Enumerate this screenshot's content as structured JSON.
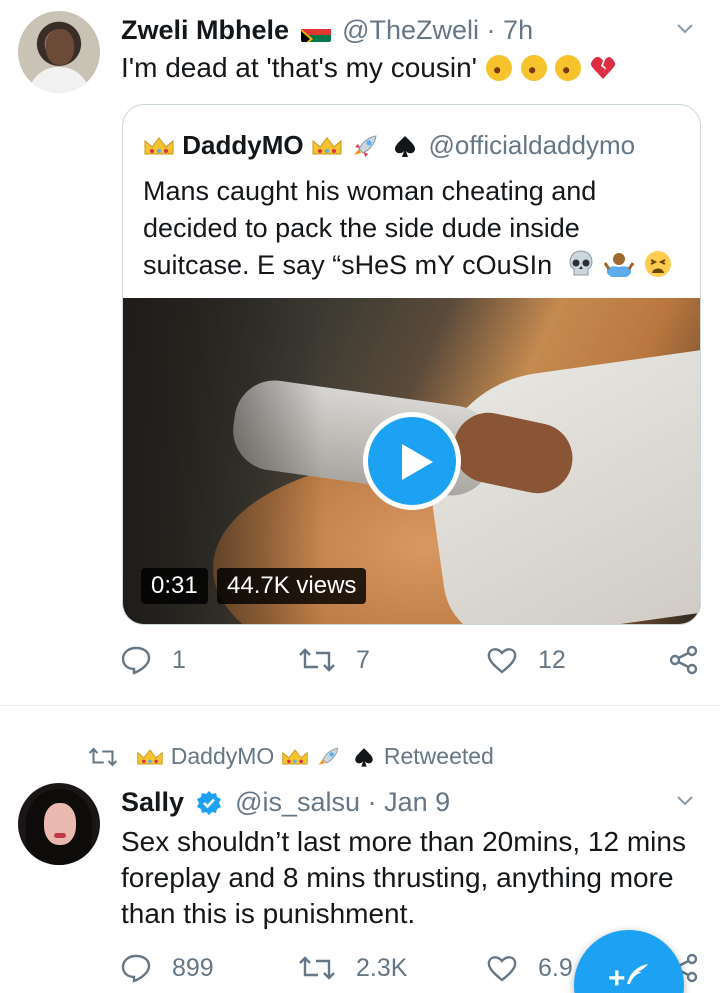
{
  "tweet1": {
    "author_name": "Zweli Mbhele",
    "author_handle": "@TheZweli",
    "separator": "·",
    "time": "7h",
    "text": "I'm dead at 'that's my cousin'",
    "emojis": [
      "rolling-on-floor-laughing",
      "rolling-on-floor-laughing",
      "rolling-on-floor-laughing",
      "broken-heart"
    ],
    "quote": {
      "author_name": "DaddyMO",
      "author_handle": "@officialdaddymo",
      "text": "Mans caught his woman cheating and decided to pack the side dude inside suitcase. E say “sHeS mY cOuSIn",
      "video_duration": "0:31",
      "video_views": "44.7K views"
    },
    "replies": "1",
    "retweets": "7",
    "likes": "12"
  },
  "tweet2": {
    "retweeted_by": "DaddyMO",
    "retweeted_label": "Retweeted",
    "author_name": "Sally",
    "author_handle": "@is_salsu",
    "separator": "·",
    "time": "Jan 9",
    "text": "Sex shouldn’t last more than 20mins, 12 mins foreplay and 8 mins thrusting, anything more than this is punishment.",
    "replies": "899",
    "retweets": "2.3K",
    "likes": "6.9"
  },
  "icons": [
    "south-africa-flag-icon",
    "crown-icon",
    "rocket-icon",
    "spade-icon",
    "skull-icon",
    "shrug-icon",
    "weary-face-icon",
    "verified-icon",
    "reply-icon",
    "retweet-icon",
    "like-icon",
    "share-icon",
    "chevron-down-icon",
    "compose-icon"
  ],
  "colors": {
    "accent": "#1da1f2",
    "muted": "#657786",
    "border": "#ccd6dd"
  },
  "fab": {
    "label": "+"
  }
}
